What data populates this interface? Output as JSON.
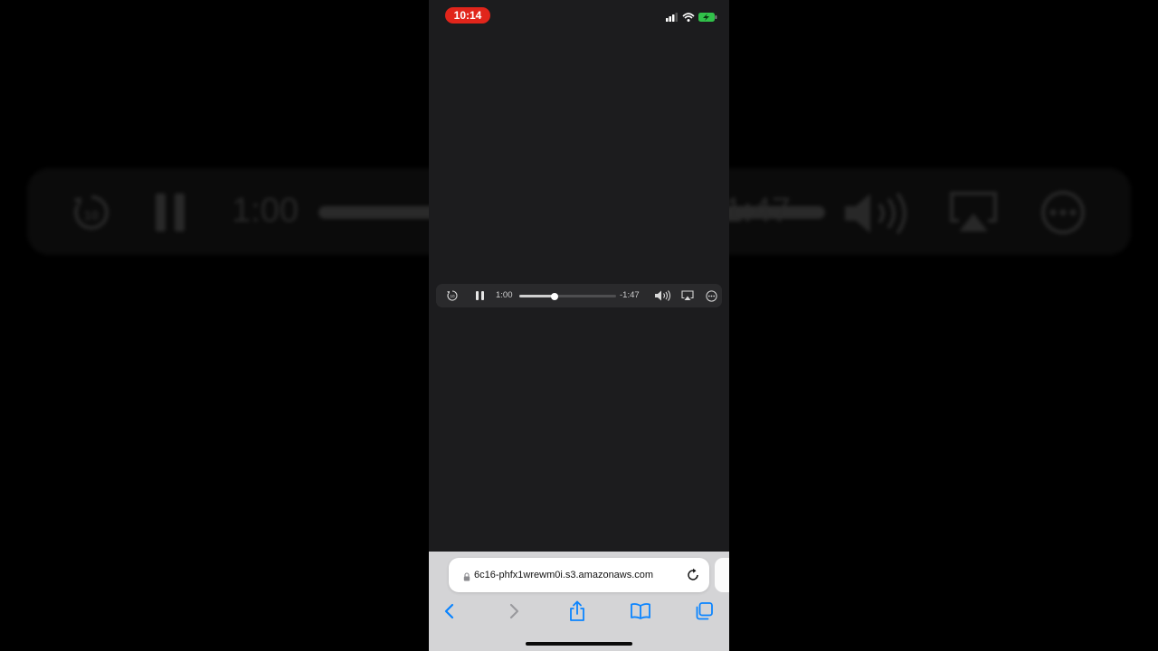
{
  "status_bar": {
    "time": "10:14",
    "time_pill_color": "#e1251b",
    "icons": [
      "signal-icon",
      "wifi-icon",
      "battery-charging-icon"
    ]
  },
  "player": {
    "elapsed": "1:00",
    "remaining": "-1:47",
    "progress": 0.36,
    "icons": [
      "skip-back-10-icon",
      "pause-icon",
      "volume-icon",
      "airplay-icon",
      "more-icon"
    ]
  },
  "backdrop": {
    "elapsed": "1:00",
    "remaining": "1:47"
  },
  "safari": {
    "url": "6c16-phfx1wrewm0i.s3.amazonaws.com",
    "toolbar": [
      "back-icon",
      "forward-icon",
      "share-icon",
      "bookmarks-icon",
      "tabs-icon"
    ],
    "accent": "#0a84ff"
  }
}
